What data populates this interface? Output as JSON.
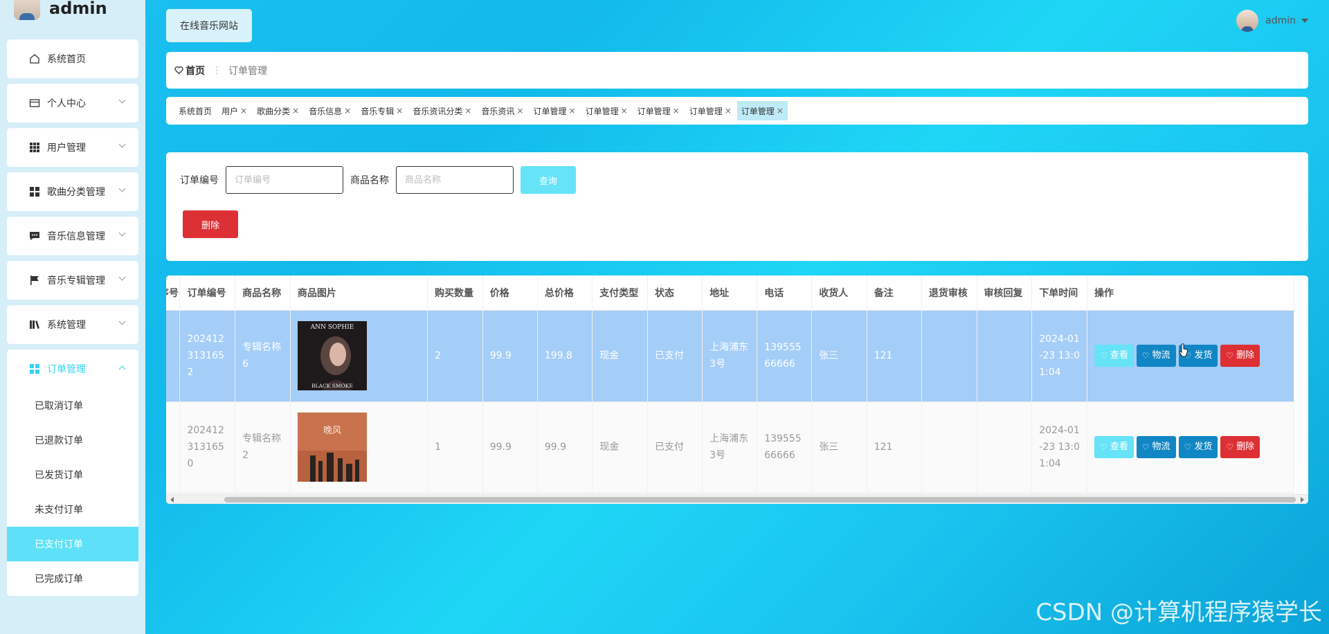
{
  "app": {
    "username": "admin",
    "site_button": "在线音乐网站"
  },
  "sidebar": {
    "items": [
      {
        "label": "系统首页",
        "icon": "home-icon"
      },
      {
        "label": "个人中心",
        "icon": "id-card-icon"
      },
      {
        "label": "用户管理",
        "icon": "grid-icon"
      },
      {
        "label": "歌曲分类管理",
        "icon": "grid-2x2-icon"
      },
      {
        "label": "音乐信息管理",
        "icon": "chat-icon"
      },
      {
        "label": "音乐专辑管理",
        "icon": "flag-icon"
      },
      {
        "label": "系统管理",
        "icon": "book-icon"
      },
      {
        "label": "订单管理",
        "icon": "grid-2x2-icon"
      }
    ],
    "sub_items": [
      "已取消订单",
      "已退款订单",
      "已发货订单",
      "未支付订单",
      "已支付订单",
      "已完成订单"
    ]
  },
  "breadcrumb": {
    "home": "首页",
    "current": "订单管理"
  },
  "tabs": [
    "系统首页",
    "用户",
    "歌曲分类",
    "音乐信息",
    "音乐专辑",
    "音乐资讯分类",
    "音乐资讯",
    "订单管理",
    "订单管理",
    "订单管理",
    "订单管理",
    "订单管理"
  ],
  "search": {
    "order_label": "订单编号",
    "order_placeholder": "订单编号",
    "goods_label": "商品名称",
    "goods_placeholder": "商品名称",
    "query_button": "查询",
    "delete_button": "删除"
  },
  "table": {
    "headers": [
      "序号",
      "订单编号",
      "商品名称",
      "商品图片",
      "购买数量",
      "价格",
      "总价格",
      "支付类型",
      "状态",
      "地址",
      "电话",
      "收货人",
      "备注",
      "退货审核",
      "审核回复",
      "下单时间",
      "操作"
    ],
    "rows": [
      {
        "order_no": "2024123131652",
        "goods": "专辑名称6",
        "qty": "2",
        "price": "99.9",
        "total": "199.8",
        "pay": "现金",
        "status": "已支付",
        "address": "上海浦东3号",
        "phone": "13955566666",
        "receiver": "张三",
        "note": "121",
        "return_review": "",
        "review_reply": "",
        "time": "2024-01-23 13:01:04",
        "img_text": "ANN SOPHIE",
        "img_sub": "BLACK SMOKE"
      },
      {
        "order_no": "2024123131650",
        "goods": "专辑名称2",
        "qty": "1",
        "price": "99.9",
        "total": "99.9",
        "pay": "现金",
        "status": "已支付",
        "address": "上海浦东3号",
        "phone": "13955566666",
        "receiver": "张三",
        "note": "121",
        "return_review": "",
        "review_reply": "",
        "time": "2024-01-23 13:01:04",
        "img_text": "晚风"
      }
    ],
    "actions": {
      "view": "查看",
      "logistics": "物流",
      "ship": "发货",
      "delete": "删除"
    }
  },
  "watermark": "CSDN @计算机程序猿学长",
  "colors": {
    "accent": "#35d3f3",
    "active_sub": "#5ee1f8",
    "danger": "#dd3035",
    "primary": "#1186c4",
    "row_selected": "#a4cdf8"
  }
}
